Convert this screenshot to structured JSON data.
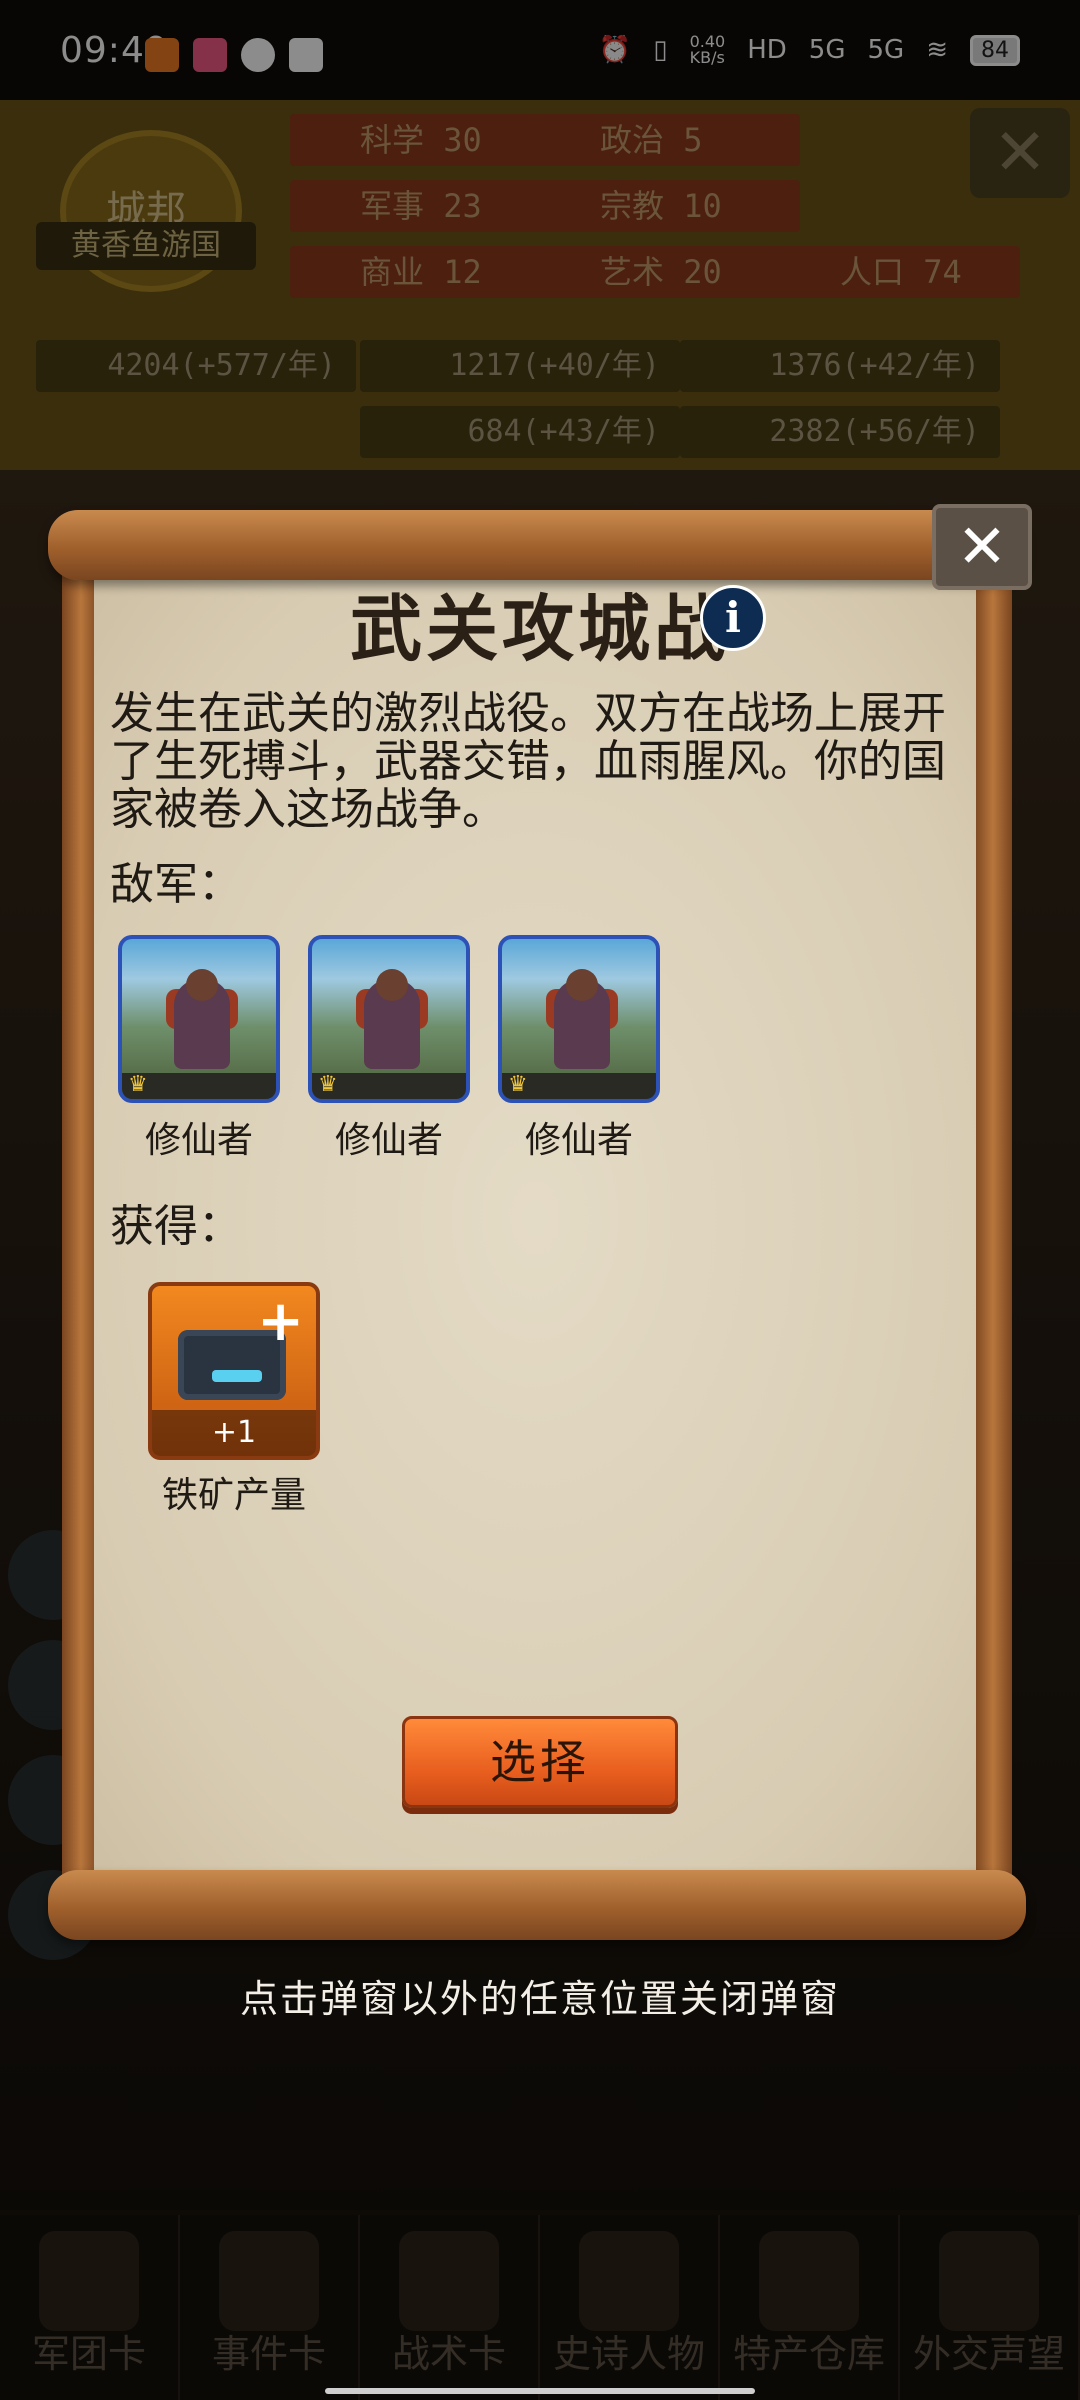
{
  "status_bar": {
    "time": "09:49",
    "net_speed": "0.40\nKB/s",
    "hd": "HD",
    "signal1": "5G",
    "signal2": "5G",
    "battery": "84"
  },
  "header": {
    "emblem_text": "城邦",
    "state_name": "黄香鱼游国",
    "stats": [
      {
        "label": "科学 30"
      },
      {
        "label": "政治 5"
      },
      {
        "label": "军事 23"
      },
      {
        "label": "宗教 10"
      },
      {
        "label": "商业 12"
      },
      {
        "label": "艺术 20"
      },
      {
        "label": "人口 74"
      }
    ],
    "resources": [
      {
        "value": "4204(+577/年)"
      },
      {
        "value": "1217(+40/年)"
      },
      {
        "value": "1376(+42/年)"
      },
      {
        "value": "684(+43/年)"
      },
      {
        "value": "2382(+56/年)"
      }
    ],
    "close_icon": "close-icon"
  },
  "dialog": {
    "title": "武关攻城战",
    "info_icon": "i",
    "description": "发生在武关的激烈战役。双方在战场上展开了生死搏斗，武器交错，血雨腥风。你的国家被卷入这场战争。",
    "enemy_label": "敌军：",
    "enemies": [
      {
        "name": "修仙者"
      },
      {
        "name": "修仙者"
      },
      {
        "name": "修仙者"
      }
    ],
    "reward_label": "获得：",
    "reward": {
      "name": "铁矿产量",
      "count": "+1",
      "plus": "+"
    },
    "choose_button": "选择",
    "close_symbol": "✕"
  },
  "hint": "点击弹窗以外的任意位置关闭弹窗",
  "bottom_nav": [
    {
      "label": "军团卡"
    },
    {
      "label": "事件卡"
    },
    {
      "label": "战术卡"
    },
    {
      "label": "史诗人物"
    },
    {
      "label": "特产仓库"
    },
    {
      "label": "外交声望"
    }
  ],
  "colors": {
    "parchment": "#ded3bd",
    "scroll_wood": "#a0602c",
    "button_orange": "#e95f1f",
    "enemy_border": "#2c52b8"
  }
}
